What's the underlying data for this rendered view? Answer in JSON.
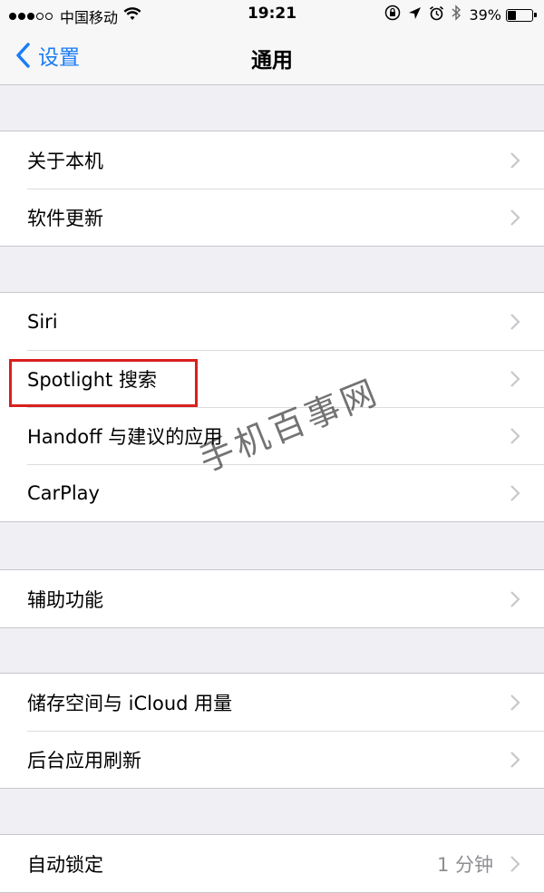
{
  "status_bar": {
    "carrier": "中国移动",
    "time": "19:21",
    "battery_pct": "39%",
    "battery_level": 0.39,
    "signal_dots_filled": 3,
    "signal_dots_total": 5
  },
  "nav": {
    "back_label": "设置",
    "title": "通用"
  },
  "groups": [
    {
      "rows": [
        {
          "label": "关于本机"
        },
        {
          "label": "软件更新"
        }
      ]
    },
    {
      "rows": [
        {
          "label": "Siri"
        },
        {
          "label": "Spotlight 搜索"
        },
        {
          "label": "Handoff 与建议的应用"
        },
        {
          "label": "CarPlay"
        }
      ]
    },
    {
      "rows": [
        {
          "label": "辅助功能"
        }
      ]
    },
    {
      "rows": [
        {
          "label": "储存空间与 iCloud 用量"
        },
        {
          "label": "后台应用刷新"
        }
      ]
    },
    {
      "rows": [
        {
          "label": "自动锁定",
          "value": "1 分钟"
        }
      ]
    }
  ],
  "watermark": "手机百事网",
  "colors": {
    "accent": "#1a7cf5",
    "highlight": "#d7201f",
    "background": "#efeff4"
  },
  "icons": [
    "wifi-icon",
    "orientation-lock-icon",
    "location-icon",
    "alarm-icon",
    "bluetooth-icon",
    "battery-icon",
    "back-chevron-icon",
    "chevron-right-icon"
  ]
}
